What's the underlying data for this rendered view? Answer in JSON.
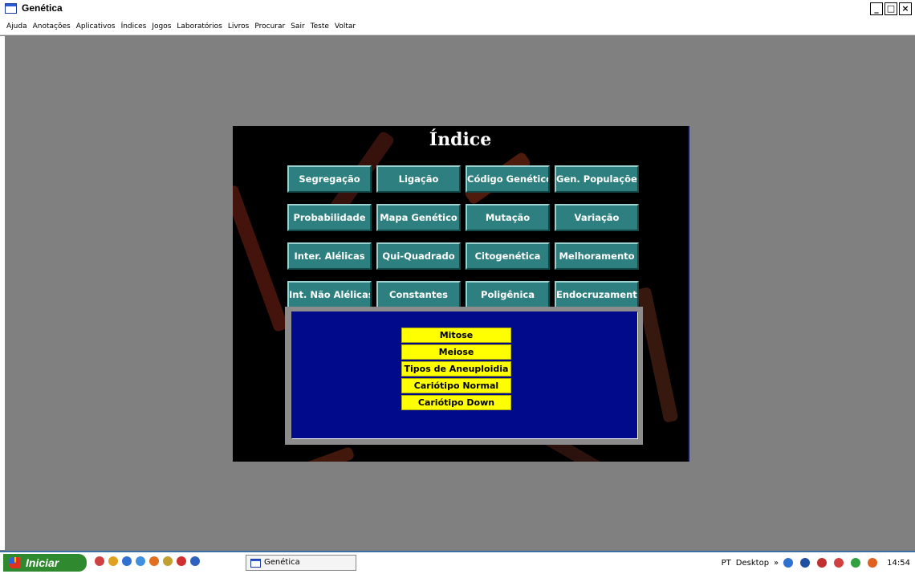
{
  "window": {
    "title": "Genética",
    "controls": [
      "_",
      "□",
      "×"
    ]
  },
  "menu": [
    "Ajuda",
    "Anotações",
    "Aplicativos",
    "Índices",
    "Jogos",
    "Laboratórios",
    "Livros",
    "Procurar",
    "Sair",
    "Teste",
    "Voltar"
  ],
  "panel": {
    "title": "Índice",
    "topics": [
      "Segregação",
      "Ligação",
      "Código Genético",
      "Gen. Populações",
      "Probabilidade",
      "Mapa Genético",
      "Mutação",
      "Variação",
      "Inter. Alélicas",
      "Qui-Quadrado",
      "Citogenética",
      "Melhoramento",
      "Int. Não Alélicas",
      "Constantes",
      "Poligênica",
      "Endocruzamento"
    ],
    "subtopics": [
      "Mitose",
      "Meiose",
      "Tipos de Aneuploidia",
      "Cariótipo Normal",
      "Cariótipo Down"
    ]
  },
  "taskbar": {
    "start_label": "Iniciar",
    "task_label": "Genética",
    "tray_lang": "PT",
    "tray_desktop": "Desktop",
    "tray_chevron": "»",
    "clock": "14:54"
  },
  "colors": {
    "workspace": "#808080",
    "topic_button": "#2e8080",
    "subpanel_blue": "#000a8a",
    "subtopic_button": "#ffff00"
  },
  "icons": [
    "app-window-icon",
    "minimize-icon",
    "restore-icon",
    "close-icon",
    "windows-logo-icon"
  ]
}
